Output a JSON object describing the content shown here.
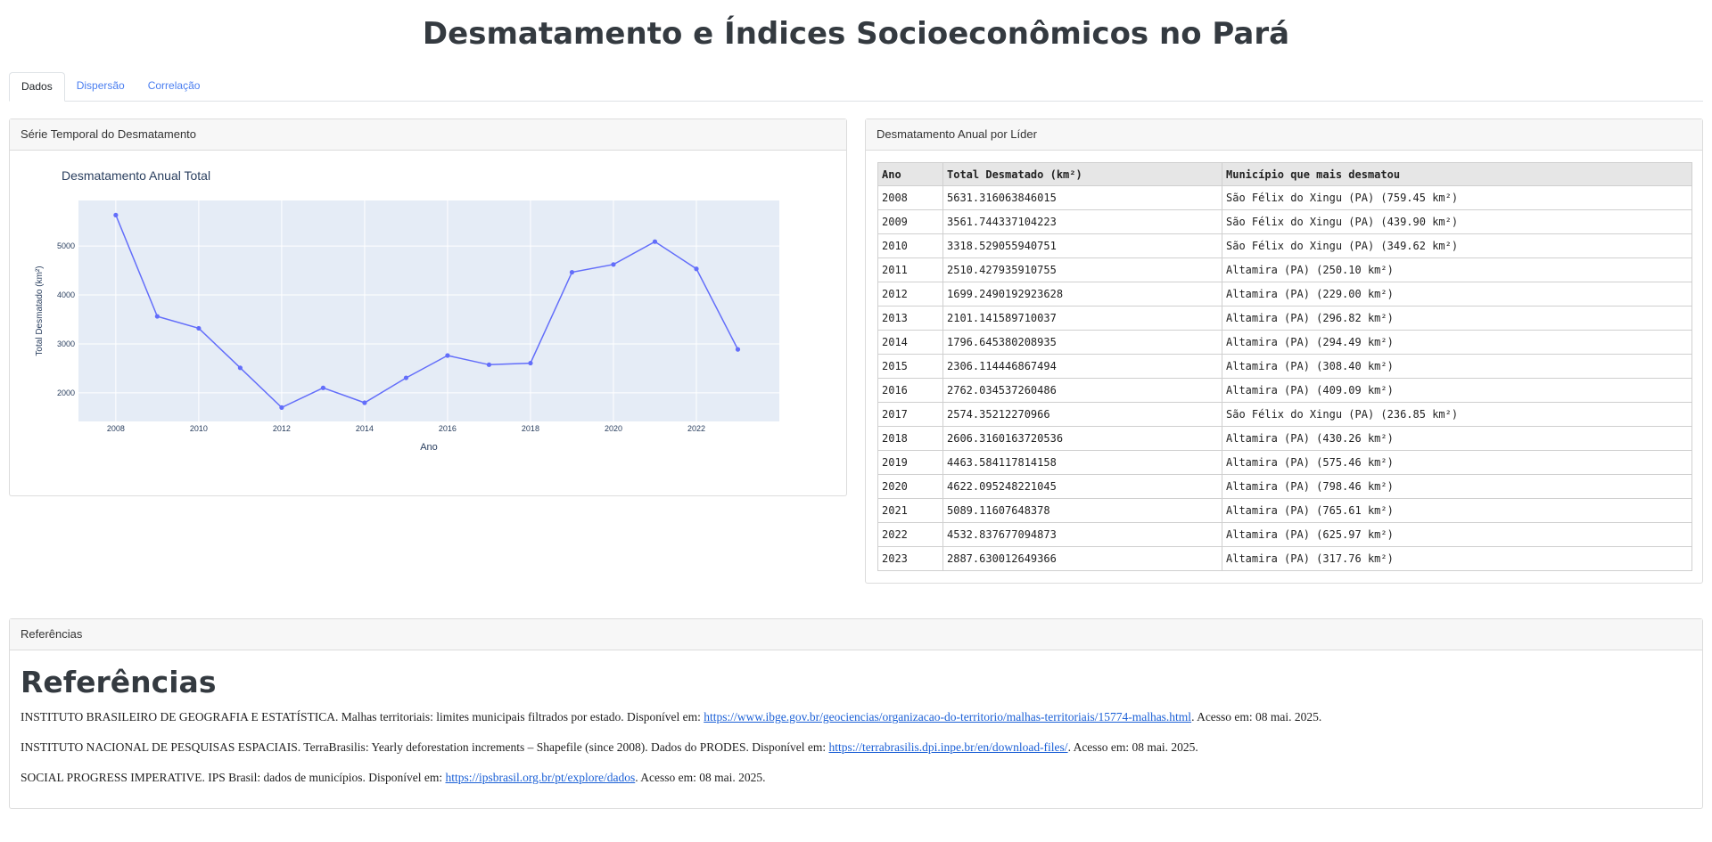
{
  "title": "Desmatamento e Índices Socioeconômicos no Pará",
  "tabs": [
    {
      "label": "Dados",
      "active": true
    },
    {
      "label": "Dispersão",
      "active": false
    },
    {
      "label": "Correlação",
      "active": false
    }
  ],
  "chart_card": {
    "header": "Série Temporal do Desmatamento"
  },
  "chart_data": {
    "type": "line",
    "title": "Desmatamento Anual Total",
    "xlabel": "Ano",
    "ylabel": "Total Desmatado (km²)",
    "x": [
      2008,
      2009,
      2010,
      2011,
      2012,
      2013,
      2014,
      2015,
      2016,
      2017,
      2018,
      2019,
      2020,
      2021,
      2022,
      2023
    ],
    "y": [
      5631.32,
      3561.74,
      3318.53,
      2510.43,
      1699.25,
      2101.14,
      1796.65,
      2306.11,
      2762.03,
      2574.35,
      2606.32,
      4463.58,
      4622.1,
      5089.12,
      4532.84,
      2887.63
    ],
    "xticks": [
      2008,
      2010,
      2012,
      2014,
      2016,
      2018,
      2020,
      2022
    ],
    "yticks": [
      2000,
      3000,
      4000,
      5000
    ],
    "xlim": [
      2007.1,
      2024.0
    ],
    "ylim": [
      1415,
      5930
    ],
    "grid": true,
    "colors": {
      "line": "#636efa",
      "plot_bg": "#e5ecf6",
      "grid": "#ffffff",
      "title": "#2a3f5f"
    }
  },
  "table_card": {
    "header": "Desmatamento Anual por Líder",
    "columns": [
      "Ano",
      "Total Desmatado (km²)",
      "Município que mais desmatou"
    ],
    "rows": [
      [
        "2008",
        "5631.316063846015",
        "São Félix do Xingu (PA) (759.45 km²)"
      ],
      [
        "2009",
        "3561.744337104223",
        "São Félix do Xingu (PA) (439.90 km²)"
      ],
      [
        "2010",
        "3318.529055940751",
        "São Félix do Xingu (PA) (349.62 km²)"
      ],
      [
        "2011",
        "2510.427935910755",
        "Altamira (PA) (250.10 km²)"
      ],
      [
        "2012",
        "1699.2490192923628",
        "Altamira (PA) (229.00 km²)"
      ],
      [
        "2013",
        "2101.141589710037",
        "Altamira (PA) (296.82 km²)"
      ],
      [
        "2014",
        "1796.645380208935",
        "Altamira (PA) (294.49 km²)"
      ],
      [
        "2015",
        "2306.114446867494",
        "Altamira (PA) (308.40 km²)"
      ],
      [
        "2016",
        "2762.034537260486",
        "Altamira (PA) (409.09 km²)"
      ],
      [
        "2017",
        "2574.35212270966",
        "São Félix do Xingu (PA) (236.85 km²)"
      ],
      [
        "2018",
        "2606.3160163720536",
        "Altamira (PA) (430.26 km²)"
      ],
      [
        "2019",
        "4463.584117814158",
        "Altamira (PA) (575.46 km²)"
      ],
      [
        "2020",
        "4622.095248221045",
        "Altamira (PA) (798.46 km²)"
      ],
      [
        "2021",
        "5089.11607648378",
        "Altamira (PA) (765.61 km²)"
      ],
      [
        "2022",
        "4532.837677094873",
        "Altamira (PA) (625.97 km²)"
      ],
      [
        "2023",
        "2887.630012649366",
        "Altamira (PA) (317.76 km²)"
      ]
    ]
  },
  "refs_card": {
    "header": "Referências",
    "heading": "Referências",
    "items": [
      {
        "before": "INSTITUTO BRASILEIRO DE GEOGRAFIA E ESTATÍSTICA. Malhas territoriais: limites municipais filtrados por estado. Disponível em: ",
        "link": "https://www.ibge.gov.br/geociencias/organizacao-do-territorio/malhas-territoriais/15774-malhas.html",
        "after": ". Acesso em: 08 mai. 2025."
      },
      {
        "before": "INSTITUTO NACIONAL DE PESQUISAS ESPACIAIS. TerraBrasilis: Yearly deforestation increments – Shapefile (since 2008). Dados do PRODES. Disponível em: ",
        "link": "https://terrabrasilis.dpi.inpe.br/en/download-files/",
        "after": ". Acesso em: 08 mai. 2025."
      },
      {
        "before": "SOCIAL PROGRESS IMPERATIVE. IPS Brasil: dados de municípios. Disponível em: ",
        "link": "https://ipsbrasil.org.br/pt/explore/dados",
        "after": ". Acesso em: 08 mai. 2025."
      }
    ]
  }
}
